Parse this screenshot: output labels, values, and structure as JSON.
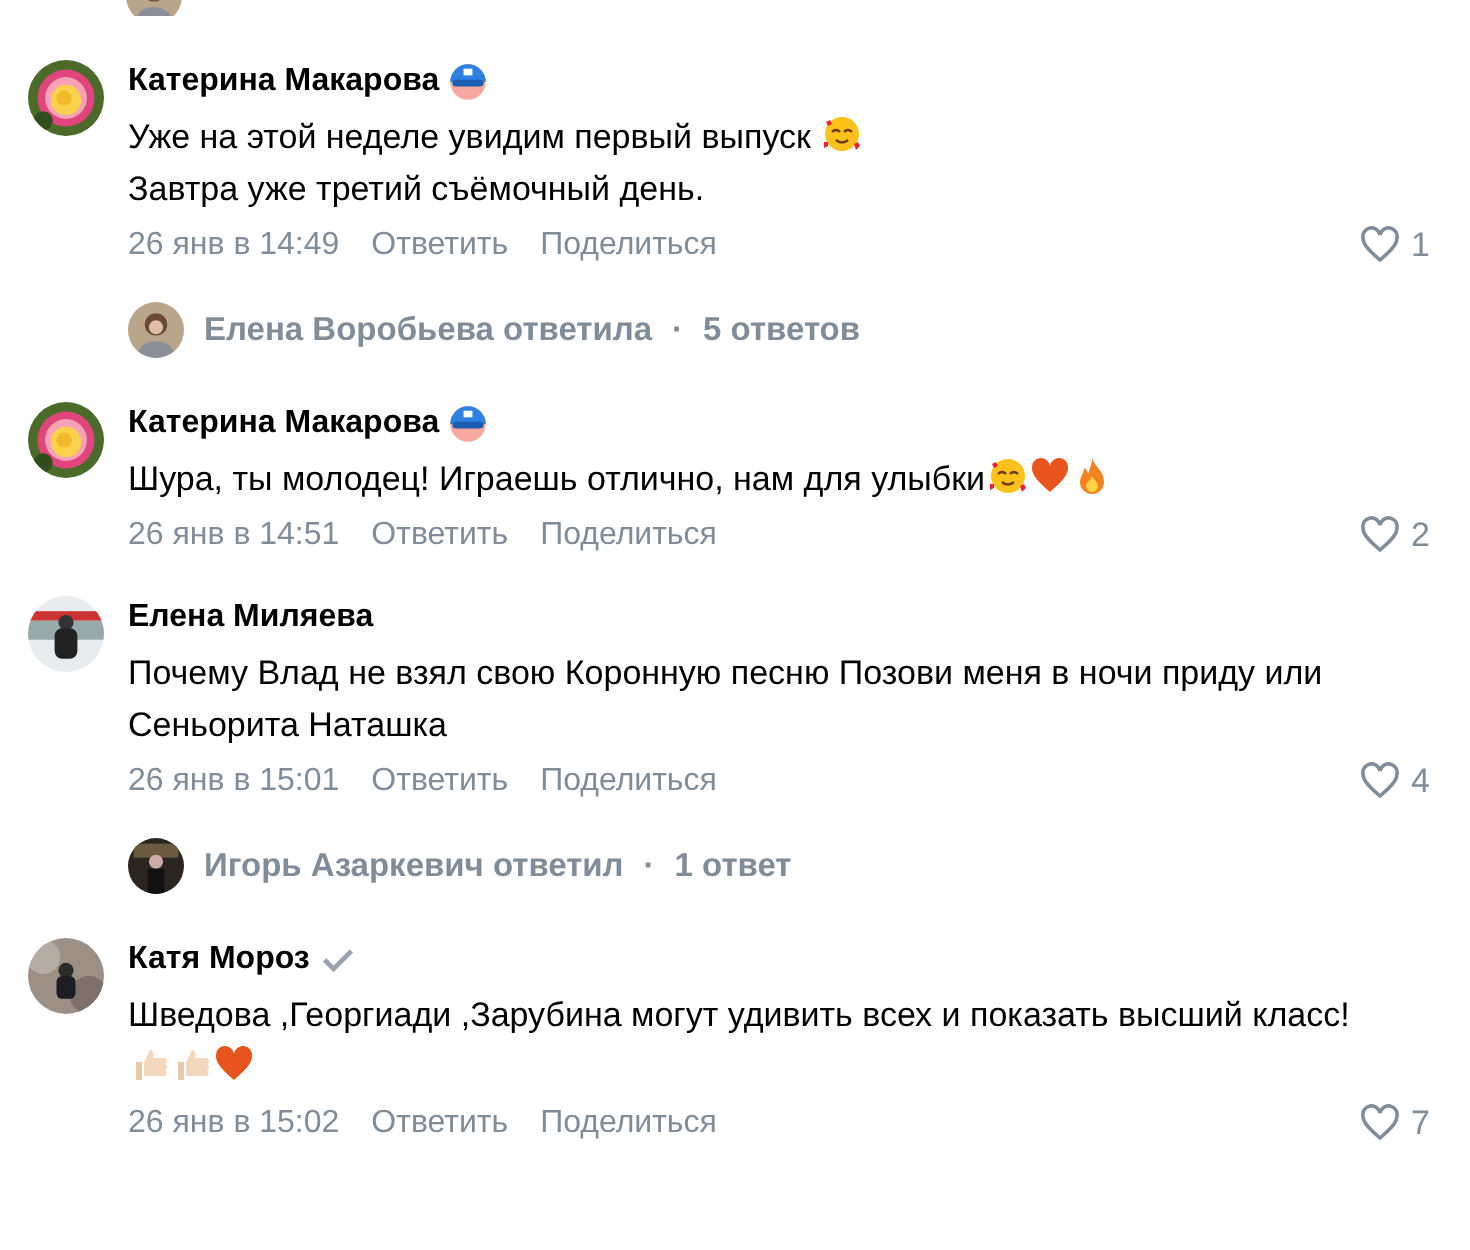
{
  "cut_reply": {
    "avatar": {
      "kind": "picture"
    }
  },
  "comments": [
    {
      "author": "Катерина Макарова",
      "badge": {
        "kind": "mask"
      },
      "avatar": {
        "kind": "picture"
      },
      "lines": [
        {
          "text": "Уже на этой неделе увидим первый выпуск ",
          "emojis": [
            {
              "kind": "hearts-face"
            }
          ]
        },
        {
          "text": "Завтра уже третий съёмочный день."
        }
      ],
      "date": "26 янв в 14:49",
      "reply": "Ответить",
      "share": "Поделиться",
      "likes": "1",
      "replies": {
        "avatar": {
          "kind": "picture"
        },
        "who": "Елена Воробьева ответила",
        "sep": "·",
        "count": "5 ответов"
      }
    },
    {
      "author": "Катерина Макарова",
      "badge": {
        "kind": "mask"
      },
      "avatar": {
        "kind": "picture"
      },
      "lines": [
        {
          "text": "Шура, ты молодец! Играешь отлично, нам для улыбки",
          "emojis": [
            {
              "kind": "hearts-face"
            },
            {
              "kind": "heart"
            },
            {
              "kind": "fire"
            }
          ]
        }
      ],
      "date": "26 янв в 14:51",
      "reply": "Ответить",
      "share": "Поделиться",
      "likes": "2"
    },
    {
      "author": "Елена Миляева",
      "avatar": {
        "kind": "picture"
      },
      "lines": [
        {
          "text": "Почему Влад не взял свою Коронную песню Позови меня в ночи приду или Сеньорита Наташка"
        }
      ],
      "date": "26 янв в 15:01",
      "reply": "Ответить",
      "share": "Поделиться",
      "likes": "4",
      "replies": {
        "avatar": {
          "kind": "picture"
        },
        "who": "Игорь Азаркевич ответил",
        "sep": "·",
        "count": "1 ответ"
      }
    },
    {
      "author": "Катя Мороз",
      "badge": {
        "kind": "check"
      },
      "avatar": {
        "kind": "picture"
      },
      "lines": [
        {
          "text": "Шведова ,Георгиади ,Зарубина могут удивить всех и показать высший класс!",
          "emojis": [
            {
              "kind": "thumbs-up"
            },
            {
              "kind": "thumbs-up"
            },
            {
              "kind": "heart"
            }
          ]
        }
      ],
      "date": "26 янв в 15:02",
      "reply": "Ответить",
      "share": "Поделиться",
      "likes": "7"
    }
  ]
}
